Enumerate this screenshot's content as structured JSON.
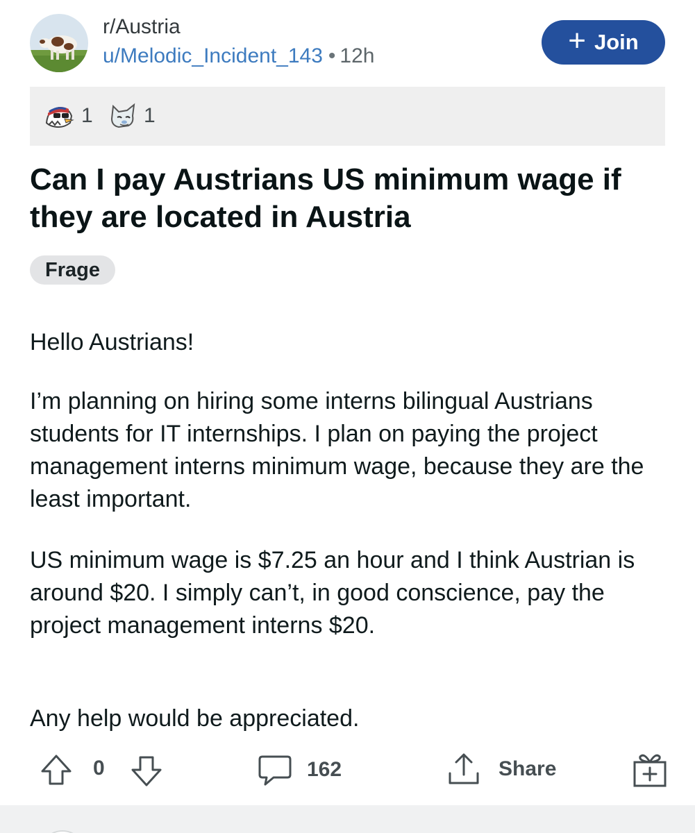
{
  "post": {
    "subreddit": "r/Austria",
    "author": "u/Melodic_Incident_143",
    "separator": "•",
    "time_ago": "12h",
    "join_label": "Join",
    "awards": [
      {
        "icon": "eagle-award-icon",
        "count": "1"
      },
      {
        "icon": "wolf-award-icon",
        "count": "1"
      }
    ],
    "title": "Can I pay Austrians US minimum wage if they are located in Austria",
    "flair": "Frage",
    "body": [
      "Hello Austrians!",
      "I’m planning on hiring some interns bilingual Austrians students for IT internships. I plan on paying the project management interns minimum wage, because they are the least important.",
      "US minimum wage is $7.25 an hour and I think Austrian is around $20. I simply can’t, in good conscience, pay the project management interns $20.",
      "Any help would be appreciated."
    ]
  },
  "actions": {
    "vote_count": "0",
    "comment_count": "162",
    "share_label": "Share"
  },
  "colors": {
    "join_button": "#24509d",
    "username": "#3d7bbf",
    "awards_bar": "#efefef",
    "flair_bg": "#e3e4e6"
  }
}
